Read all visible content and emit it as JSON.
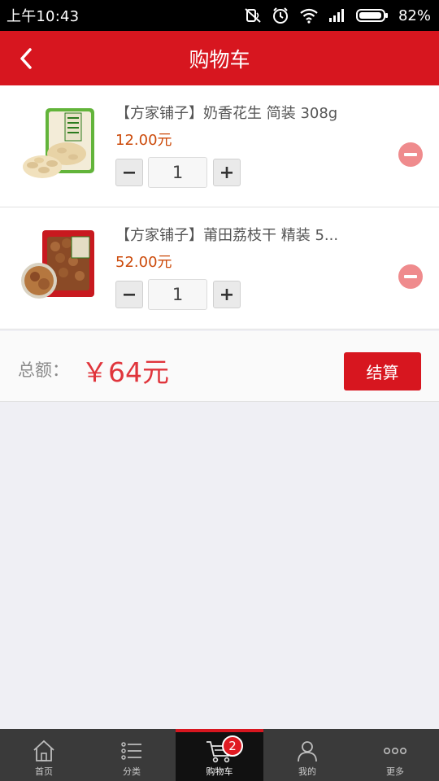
{
  "status_bar": {
    "time": "上午10:43",
    "battery": "82%",
    "icons": [
      "mute-icon",
      "alarm-icon",
      "wifi-icon",
      "signal-icon",
      "battery-icon"
    ]
  },
  "header": {
    "title": "购物车",
    "back_icon": "chevron-left-icon",
    "color": "#d7161f"
  },
  "cart": {
    "items": [
      {
        "title": "【方家铺子】奶香花生 简装 308g",
        "price": "12.00元",
        "quantity": "1",
        "minus": "−",
        "plus": "+"
      },
      {
        "title": "【方家铺子】莆田荔枝干 精装 5...",
        "price": "52.00元",
        "quantity": "1",
        "minus": "−",
        "plus": "+"
      }
    ]
  },
  "summary": {
    "total_label": "总额：",
    "total_value": "￥64元",
    "checkout_label": "结算"
  },
  "bottom_nav": {
    "items": [
      {
        "label": "首页",
        "icon": "home-icon"
      },
      {
        "label": "分类",
        "icon": "list-icon"
      },
      {
        "label": "购物车",
        "icon": "cart-icon",
        "badge": "2",
        "active": true
      },
      {
        "label": "我的",
        "icon": "user-icon"
      },
      {
        "label": "更多",
        "icon": "more-icon"
      }
    ]
  }
}
